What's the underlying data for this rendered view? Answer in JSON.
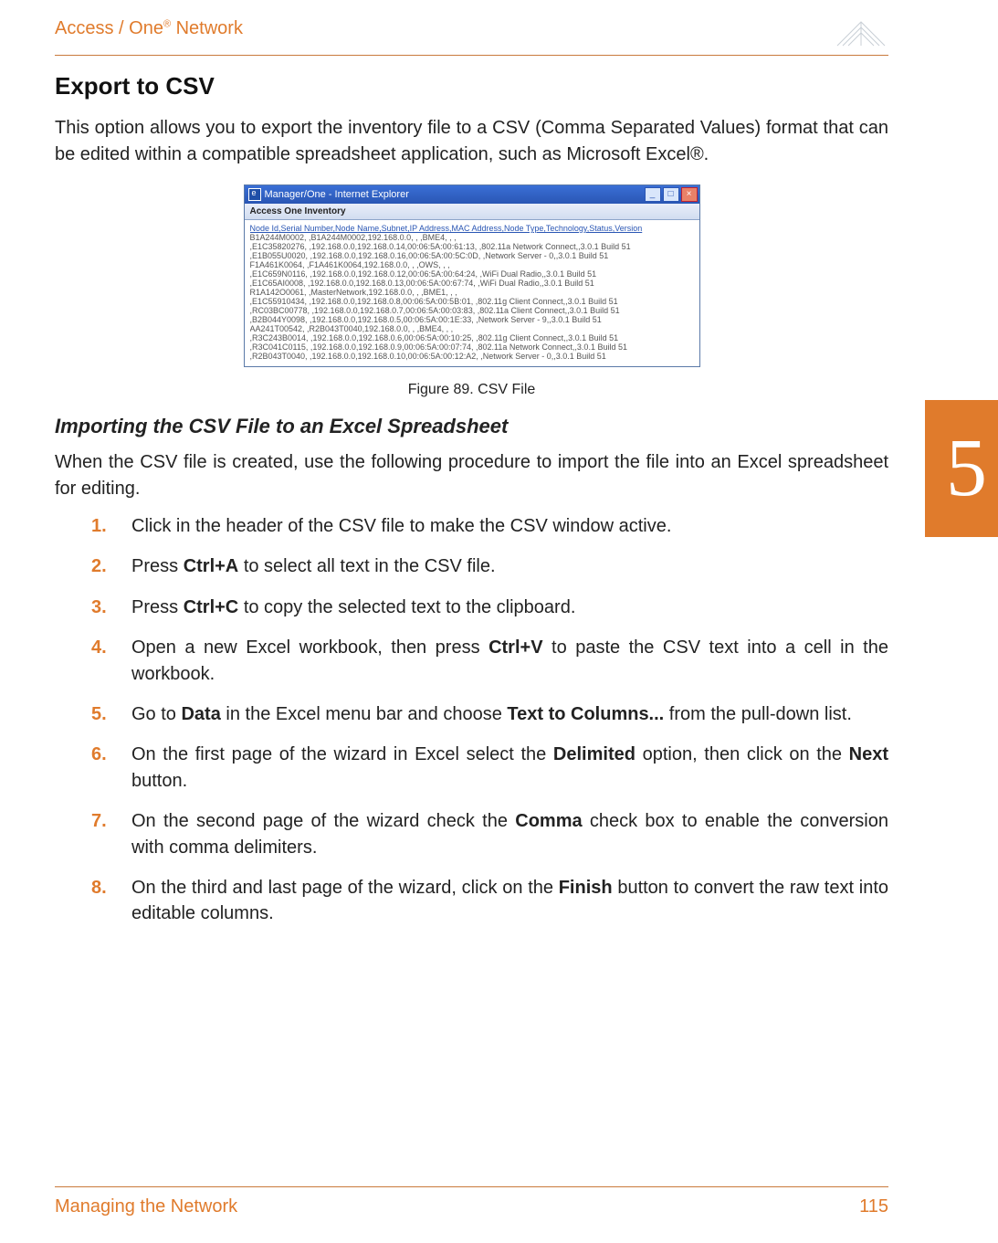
{
  "header": {
    "brand_prefix": "Access / One",
    "brand_reg": "®",
    "brand_suffix": " Network"
  },
  "main": {
    "heading": "Export to CSV",
    "intro": "This option allows you to export the inventory file to a CSV (Comma Separated Values) format that can be edited within a compatible spreadsheet application, such as Microsoft Excel®."
  },
  "figure": {
    "window_title": "Manager/One - Internet Explorer",
    "toolbar_label": "Access One Inventory",
    "csv_header": "Node Id,Serial Number,Node Name,Subnet,IP Address,MAC Address,Node Type,Technology,Status,Version",
    "rows": [
      "B1A244M0002, ,B1A244M0002,192.168.0.0, , ,BME4, , ,",
      ",E1C35820276, ,192.168.0.0,192.168.0.14,00:06:5A:00:61:13, ,802.11a Network Connect,,3.0.1 Build 51",
      ",E1B055U0020, ,192.168.0.0,192.168.0.16,00:06:5A:00:5C:0D, ,Network Server - 0,,3.0.1 Build 51",
      "F1A461K0064, ,F1A461K0064,192.168.0.0, , ,OWS, , ,",
      ",E1C659N0116, ,192.168.0.0,192.168.0.12,00:06:5A:00:64:24, ,WiFi Dual Radio,,3.0.1 Build 51",
      ",E1C65AI0008, ,192.168.0.0,192.168.0.13,00:06:5A:00:67:74, ,WiFi Dual Radio,,3.0.1 Build 51",
      "R1A142O0061, ,MasterNetwork,192.168.0.0, , ,BME1, , ,",
      ",E1C55910434, ,192.168.0.0,192.168.0.8,00:06:5A:00:5B:01, ,802.11g Client Connect,,3.0.1 Build 51",
      ",RC03BC00778, ,192.168.0.0,192.168.0.7,00:06:5A:00:03:83, ,802.11a Client Connect,,3.0.1 Build 51",
      ",B2B044Y0098, ,192.168.0.0,192.168.0.5,00:06:5A:00:1E:33, ,Network Server - 9,,3.0.1 Build 51",
      "AA241T00542, ,R2B043T0040,192.168.0.0, , ,BME4, , ,",
      ",R3C243B0014, ,192.168.0.0,192.168.0.6,00:06:5A:00:10:25, ,802.11g Client Connect,,3.0.1 Build 51",
      ",R3C041C0115, ,192.168.0.0,192.168.0.9,00:06:5A:00:07:74, ,802.11a Network Connect,,3.0.1 Build 51",
      ",R2B043T0040, ,192.168.0.0,192.168.0.10,00:06:5A:00:12:A2, ,Network Server - 0,,3.0.1 Build 51"
    ],
    "caption": "Figure 89. CSV File"
  },
  "import": {
    "heading": "Importing the CSV File to an Excel Spreadsheet",
    "intro": "When the CSV file is created, use the following procedure to import the file into an Excel spreadsheet for editing.",
    "steps": [
      {
        "num": "1.",
        "pre": "Click in the header of the CSV file to make the CSV window active."
      },
      {
        "num": "2.",
        "pre": "Press ",
        "k1": "Ctrl+A",
        "post": " to select all text in the CSV file."
      },
      {
        "num": "3.",
        "pre": "Press ",
        "k1": "Ctrl+C",
        "post": " to copy the selected text to the clipboard."
      },
      {
        "num": "4.",
        "pre": "Open a new Excel workbook, then press ",
        "k1": "Ctrl+V",
        "post": " to paste the CSV text into a cell in the workbook."
      },
      {
        "num": "5.",
        "pre": "Go to ",
        "k1": "Data",
        "mid": " in the Excel menu bar and choose ",
        "k2": "Text to Columns...",
        "post": " from the pull-down list."
      },
      {
        "num": "6.",
        "pre": "On the first page of the wizard in Excel select the ",
        "k1": "Delimited",
        "mid": " option, then click on the ",
        "k2": "Next",
        "post": " button."
      },
      {
        "num": "7.",
        "pre": "On the second page of the wizard check the ",
        "k1": "Comma",
        "post": " check box to enable the conversion with comma delimiters."
      },
      {
        "num": "8.",
        "pre": "On the third and last page of the wizard, click on the ",
        "k1": "Finish",
        "post": " button to convert the raw text into editable columns."
      }
    ]
  },
  "sidetab": {
    "chapter": "5"
  },
  "footer": {
    "left": "Managing the Network",
    "right": "115"
  }
}
